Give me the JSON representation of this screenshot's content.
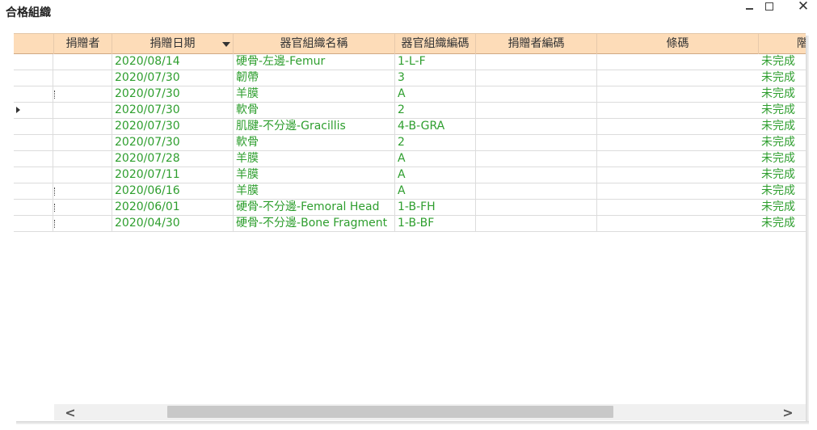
{
  "window": {
    "title": "合格組織",
    "minimize_icon": "minimize-icon",
    "maximize_icon": "maximize-icon",
    "close_icon": "close-icon",
    "close_glyph": "✕"
  },
  "grid": {
    "columns": [
      {
        "key": "selector",
        "label": ""
      },
      {
        "key": "donor",
        "label": "捐贈者"
      },
      {
        "key": "date",
        "label": "捐贈日期",
        "sorted": "descending"
      },
      {
        "key": "tissue_name",
        "label": "器官組織名稱"
      },
      {
        "key": "tissue_code",
        "label": "器官組織編碼"
      },
      {
        "key": "donor_code",
        "label": "捐贈者編碼"
      },
      {
        "key": "barcode",
        "label": "條碼"
      },
      {
        "key": "stage",
        "label": "階段"
      }
    ],
    "rows": [
      {
        "date": "2020/08/14",
        "tissue_name": "硬骨-左邊-Femur",
        "tissue_code": "1-L-F",
        "stage": "未完成"
      },
      {
        "date": "2020/07/30",
        "tissue_name": "韌帶",
        "tissue_code": "3",
        "stage": "未完成"
      },
      {
        "date": "2020/07/30",
        "tissue_name": "羊膜",
        "tissue_code": "A",
        "stage": "未完成"
      },
      {
        "date": "2020/07/30",
        "tissue_name": "軟骨",
        "tissue_code": "2",
        "stage": "未完成",
        "current": true
      },
      {
        "date": "2020/07/30",
        "tissue_name": "肌腱-不分邊-Gracillis",
        "tissue_code": "4-B-GRA",
        "stage": "未完成"
      },
      {
        "date": "2020/07/30",
        "tissue_name": "軟骨",
        "tissue_code": "2",
        "stage": "未完成"
      },
      {
        "date": "2020/07/28",
        "tissue_name": "羊膜",
        "tissue_code": "A",
        "stage": "未完成"
      },
      {
        "date": "2020/07/11",
        "tissue_name": "羊膜",
        "tissue_code": "A",
        "stage": "未完成"
      },
      {
        "date": "2020/06/16",
        "tissue_name": "羊膜",
        "tissue_code": "A",
        "stage": "未完成"
      },
      {
        "date": "2020/06/01",
        "tissue_name": "硬骨-不分邊-Femoral Head",
        "tissue_code": "1-B-FH",
        "stage": "未完成"
      },
      {
        "date": "2020/04/30",
        "tissue_name": "硬骨-不分邊-Bone Fragment",
        "tissue_code": "1-B-BF",
        "stage": "未完成"
      }
    ],
    "text_color": "#2e9e2e",
    "header_color": "#fddcb8"
  },
  "scrollbar": {
    "left_glyph": "<",
    "right_glyph": ">"
  }
}
